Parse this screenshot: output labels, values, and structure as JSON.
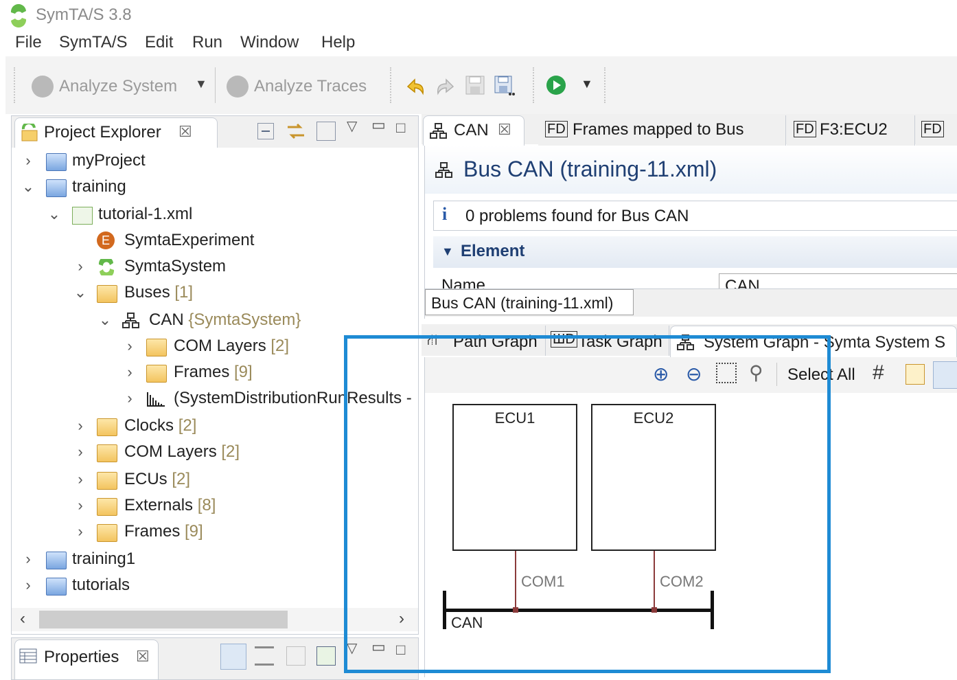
{
  "window": {
    "title": "SymTA/S 3.8"
  },
  "menu": [
    "File",
    "SymTA/S",
    "Edit",
    "Run",
    "Window",
    "Help"
  ],
  "toolbar": {
    "analyze_system": "Analyze System",
    "analyze_traces": "Analyze Traces"
  },
  "project_explorer": {
    "tab_label": "Project Explorer",
    "tree": [
      {
        "label": "myProject",
        "count": ""
      },
      {
        "label": "training",
        "count": ""
      },
      {
        "label": "tutorial-1.xml",
        "count": ""
      },
      {
        "label": "SymtaExperiment",
        "count": ""
      },
      {
        "label": "SymtaSystem",
        "count": ""
      },
      {
        "label": "Buses",
        "count": "[1]"
      },
      {
        "label": "CAN",
        "count": "{SymtaSystem}"
      },
      {
        "label": "COM Layers",
        "count": "[2]"
      },
      {
        "label": "Frames",
        "count": "[9]"
      },
      {
        "label": "(SystemDistributionRunResults -",
        "count": ""
      },
      {
        "label": "Clocks",
        "count": "[2]"
      },
      {
        "label": "COM Layers",
        "count": "[2]"
      },
      {
        "label": "ECUs",
        "count": "[2]"
      },
      {
        "label": "Externals",
        "count": "[8]"
      },
      {
        "label": "Frames",
        "count": "[9]"
      },
      {
        "label": "training1",
        "count": ""
      },
      {
        "label": "tutorials",
        "count": ""
      }
    ]
  },
  "properties": {
    "tab_label": "Properties"
  },
  "editor": {
    "tabs": [
      "CAN",
      "Frames mapped to Bus",
      "F3:ECU2"
    ],
    "header_title": "Bus CAN (training-11.xml)",
    "problems": "0 problems found for Bus CAN",
    "section": "Element",
    "name_label": "Name",
    "name_value": "CAN",
    "tooltip": "Bus CAN (training-11.xml)"
  },
  "graph_view": {
    "tabs": [
      "Path Graph",
      "Task Graph",
      "System Graph - Symta System S"
    ],
    "select_all": "Select All",
    "nodes": [
      "ECU1",
      "ECU2"
    ],
    "links": [
      "COM1",
      "COM2"
    ],
    "bus": "CAN"
  },
  "colors": {
    "highlight": "#1e8bd4",
    "link": "#8b3a3a"
  }
}
